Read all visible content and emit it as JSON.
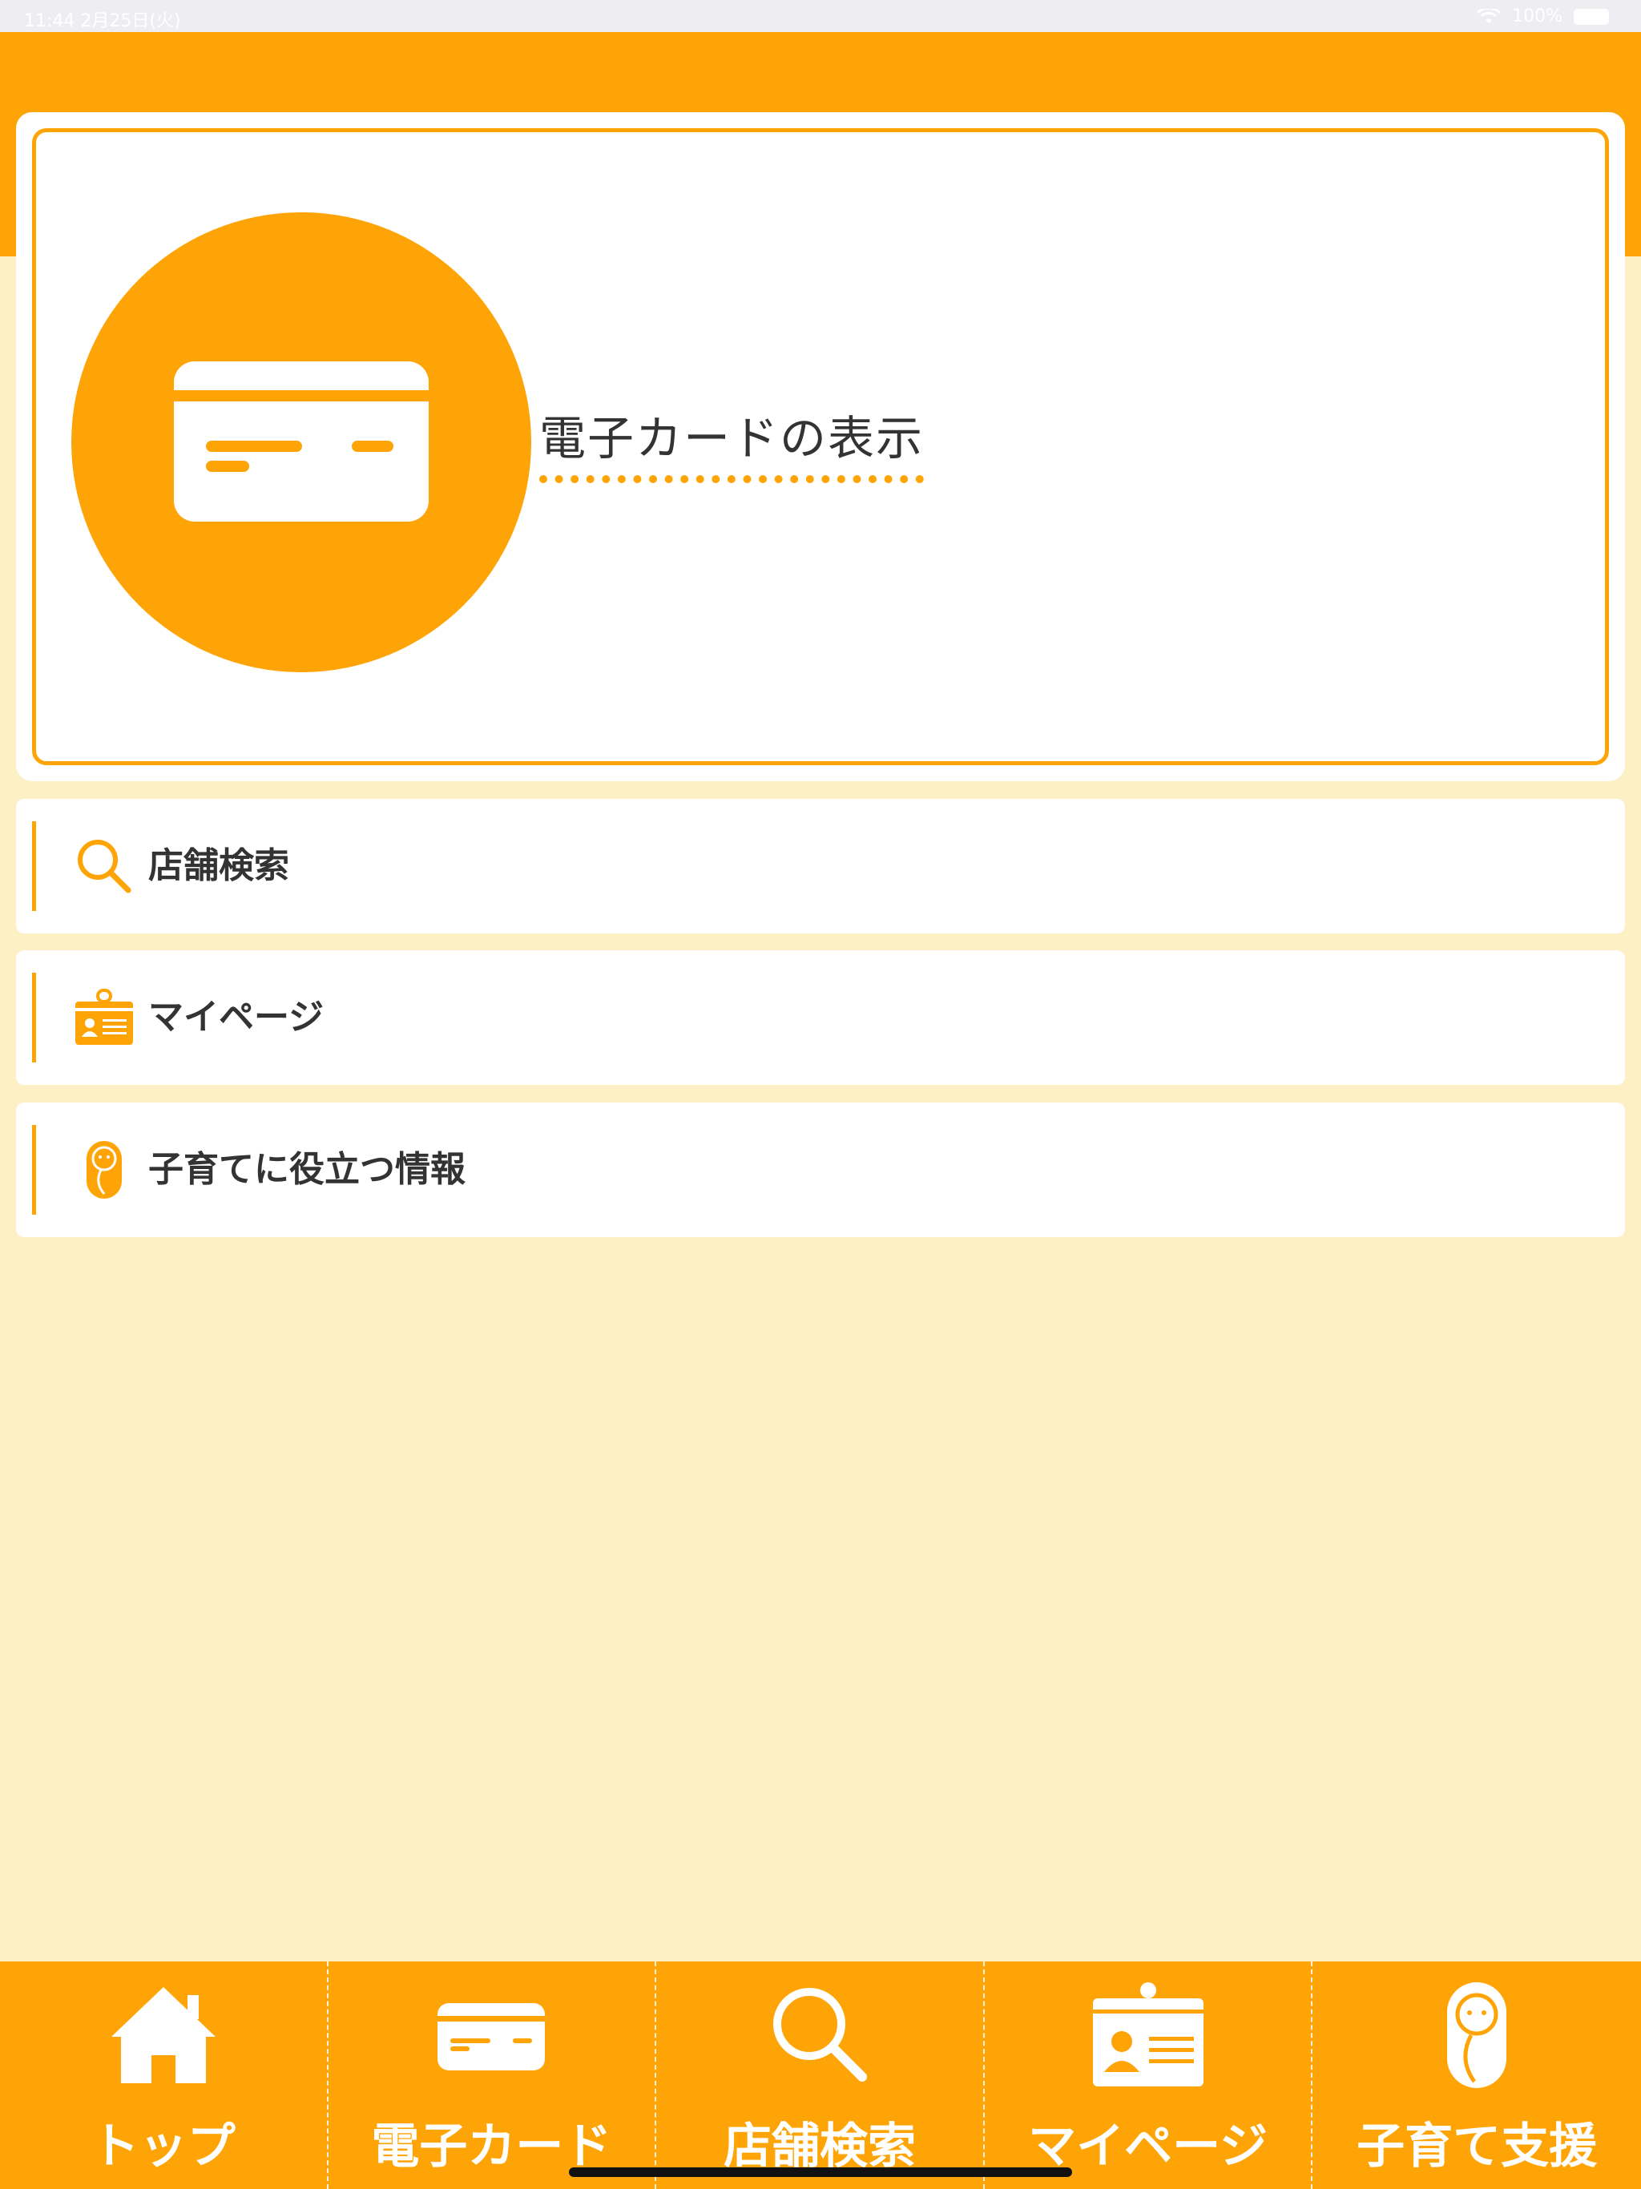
{
  "status_bar": {
    "time": "11:44 2月25日(火)",
    "battery": "100%"
  },
  "card_panel": {
    "title": "電子カードの表示",
    "icon": "credit-card-icon"
  },
  "menu": [
    {
      "label": "店舗検索",
      "icon": "search-icon"
    },
    {
      "label": "マイページ",
      "icon": "id-badge-icon"
    },
    {
      "label": "子育てに役立つ情報",
      "icon": "baby-icon"
    }
  ],
  "tabs": [
    {
      "label": "トップ",
      "icon": "home-icon"
    },
    {
      "label": "電子カード",
      "icon": "credit-card-icon"
    },
    {
      "label": "店舗検索",
      "icon": "search-icon"
    },
    {
      "label": "マイページ",
      "icon": "id-badge-icon"
    },
    {
      "label": "子育て支援",
      "icon": "baby-icon"
    }
  ],
  "colors": {
    "accent": "#FFA406",
    "background": "#FDF0C4",
    "text": "#333333"
  }
}
